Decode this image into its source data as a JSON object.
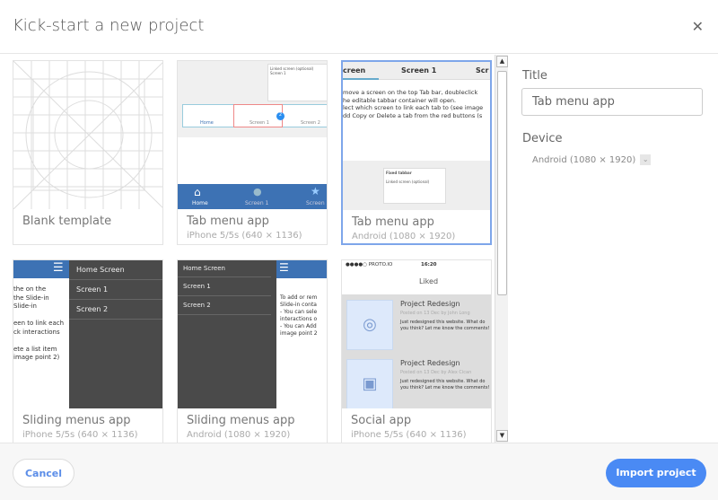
{
  "dialog": {
    "title": "Kick-start a new project",
    "close_icon": "close-icon"
  },
  "templates": [
    {
      "name": "Blank template",
      "device": ""
    },
    {
      "name": "Tab menu app",
      "device": "iPhone 5/5s (640 × 1136)",
      "tabs": [
        "Home",
        "Screen 1",
        "Screen 2"
      ],
      "badge": "2",
      "panel_label": "Linked screen (optional)",
      "panel_value": "Screen 1"
    },
    {
      "name": "Tab menu app",
      "device": "Android (1080 × 1920)",
      "tabs": [
        "creen",
        "Screen 1",
        "Scr"
      ],
      "lines": [
        "move a screen on the top Tab bar, doubleclick",
        "he editable tabbar container will open.",
        "lect which screen to link each tab to (see image",
        "dd Copy or Delete a tab from the red buttons (s"
      ],
      "panel_title": "Fixed tabbar",
      "panel_label": "Linked screen (optional)"
    },
    {
      "name": "Sliding menus app",
      "device": "iPhone 5/5s (640 × 1136)",
      "menu": [
        "Home Screen",
        "Screen 1",
        "Screen 2"
      ],
      "lines": [
        "the on the",
        "the Slide-in",
        "Slide-in",
        "",
        "een to link each",
        "ck interactions",
        "",
        "ete a list item",
        "image point 2)"
      ]
    },
    {
      "name": "Sliding menus app",
      "device": "Android (1080 × 1920)",
      "menu": [
        "Home Screen",
        "Screen 1",
        "Screen 2"
      ],
      "lines": [
        "To add or rem",
        "Slide-in conta",
        "- You can sele",
        "interactions o",
        "- You can Add",
        "image point 2"
      ]
    },
    {
      "name": "Social app",
      "device": "iPhone 5/5s (640 × 1136)",
      "status_carrier": "●●●●○ PROTO.IO",
      "status_time": "16:20",
      "header": "Liked",
      "posts": [
        {
          "title": "Project Redesign",
          "meta": "Posted on 13 Dec by John Long",
          "body": "Just redesigned this website. What do you think? Let me know the comments!"
        },
        {
          "title": "Project Redesign",
          "meta": "Posted on 13 Dec by Alex Cican",
          "body": "Just redesigned this website. What do you think? Let me know the comments!"
        }
      ]
    }
  ],
  "panel": {
    "title_label": "Title",
    "title_value": "Tab menu app",
    "device_label": "Device",
    "device_value": "Android (1080 × 1920)"
  },
  "footer": {
    "cancel": "Cancel",
    "import": "Import project"
  },
  "colors": {
    "accent": "#4a8af4",
    "tabbar": "#3d72b4",
    "menu_dark": "#4a4a4a"
  }
}
